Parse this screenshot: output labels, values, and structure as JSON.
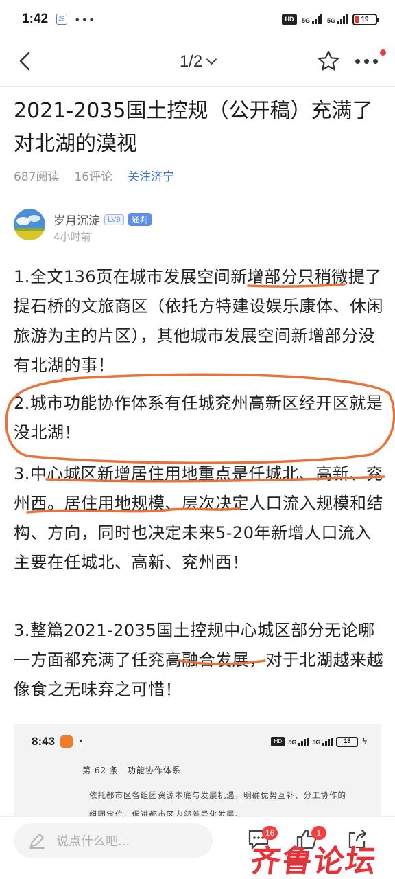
{
  "status_bar": {
    "time": "1:42",
    "date_badge": "26",
    "dots": "•••",
    "hd_label": "HD",
    "net1": "5G",
    "net2": "5G",
    "battery": "19"
  },
  "nav": {
    "pager": "1/2"
  },
  "article": {
    "title": "2021-2035国土控规（公开稿）充满了对北湖的漠视",
    "reads": "687阅读",
    "comments": "16评论",
    "follow": "关注济宁"
  },
  "author": {
    "name": "岁月沉淀",
    "level": "LV9",
    "role": "通判",
    "time": "4小时前"
  },
  "body": [
    "1.全文136页在城市发展空间新增部分只稍微提了提石桥的文旅商区（依托方特建设娱乐康体、休闲旅游为主的片区），其他城市发展空间新增部分没有北湖的事！",
    "2.城市功能协作体系有任城兖州高新区经开区就是没北湖！",
    "3.中心城区新增居住用地重点是任城北、高新、兖州西。居住用地规模、层次决定人口流入规模和结构、方向，同时也决定未来5-20年新增人口流入主要在任城北、高新、兖州西！",
    "3.整篇2021-2035国土控规中心城区部分无论哪一方面都充满了任兖高融合发展，对于北湖越来越像食之无味弃之可惜！"
  ],
  "embed": {
    "time": "8:43",
    "battery": "18",
    "heading": "第 62 条　功能协作体系",
    "text": "依托都市区各组团资源本底与发展机遇，明确优势互补、分工协作的组团定位，促进都市区内部差异化发展。"
  },
  "bottom": {
    "comment_placeholder": "说点什么吧...",
    "comment_count": "16",
    "like_count": "1"
  },
  "watermark": "齐鲁论坛",
  "colors": {
    "accent": "#3d6fd6",
    "annotation": "#e8733a",
    "badge": "#f43f3f"
  }
}
